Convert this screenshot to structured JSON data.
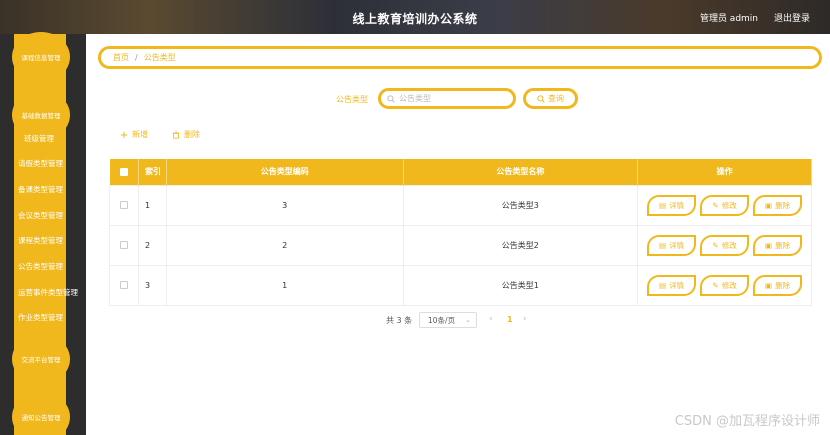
{
  "header": {
    "title": "线上教育培训办公系统",
    "user": "管理员 admin",
    "logout": "退出登录"
  },
  "sidebar": {
    "circles": [
      {
        "label": "课程信息管理"
      },
      {
        "label": "基础数据管理"
      },
      {
        "label": "交流平台管理"
      },
      {
        "label": "通知公告管理"
      }
    ],
    "subitems": [
      {
        "label": "班级管理"
      },
      {
        "label": "请假类型管理"
      },
      {
        "label": "备课类型管理"
      },
      {
        "label": "会议类型管理"
      },
      {
        "label": "课程类型管理"
      },
      {
        "label": "公告类型管理"
      },
      {
        "label": "运营事件类型管理"
      },
      {
        "label": "作业类型管理"
      }
    ]
  },
  "breadcrumb": {
    "home": "首页",
    "separator": "/",
    "current": "公告类型"
  },
  "search": {
    "label": "公告类型",
    "placeholder": "公告类型",
    "button": "查询"
  },
  "toolbar": {
    "add": "新增",
    "delete": "删除"
  },
  "table": {
    "headers": {
      "index": "索引",
      "code": "公告类型编码",
      "name": "公告类型名称",
      "ops": "操作"
    },
    "rows": [
      {
        "index": "1",
        "code": "3",
        "name": "公告类型3"
      },
      {
        "index": "2",
        "code": "2",
        "name": "公告类型2"
      },
      {
        "index": "3",
        "code": "1",
        "name": "公告类型1"
      }
    ],
    "ops": {
      "detail": "详情",
      "edit": "修改",
      "delete": "删除"
    }
  },
  "pagination": {
    "total": "共 3 条",
    "page_size": "10条/页",
    "current_page": "1"
  },
  "watermark": "CSDN @加瓦程序设计师",
  "colors": {
    "accent": "#f0b81c",
    "sidebar_bg": "#2d2d2d"
  }
}
